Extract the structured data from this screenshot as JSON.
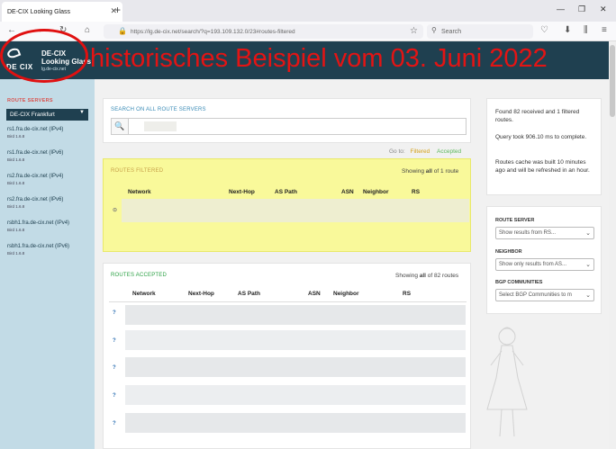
{
  "browser": {
    "tab_title": "DE-CIX Looking Glass",
    "tab_close": "✕",
    "new_tab": "+",
    "url": "https://lg.de-cix.net/search/?q=193.109.132.0/23#routes-filtered",
    "search_placeholder": "Search",
    "win_min": "—",
    "win_max": "❐",
    "win_close": "✕"
  },
  "brand": {
    "logo_text": "DE CIX",
    "title": "DE-CIX Looking Glass",
    "subtitle": "lg.de-cix.net"
  },
  "banner": "historisches Beispiel vom 03. Juni 2022",
  "sidebar": {
    "heading": "ROUTE SERVERS",
    "selected_ixp": "DE-CIX Frankfurt",
    "items": [
      {
        "label": "rs1.fra.de-cix.net (IPv4)",
        "status": "Bird 1.6.8"
      },
      {
        "label": "rs1.fra.de-cix.net (IPv6)",
        "status": "Bird 1.6.8"
      },
      {
        "label": "rs2.fra.de-cix.net (IPv4)",
        "status": "Bird 1.6.8"
      },
      {
        "label": "rs2.fra.de-cix.net (IPv6)",
        "status": "Bird 1.6.8"
      },
      {
        "label": "rsbh1.fra.de-cix.net (IPv4)",
        "status": "Bird 1.6.8"
      },
      {
        "label": "rsbh1.fra.de-cix.net (IPv6)",
        "status": "Bird 1.6.8"
      }
    ]
  },
  "search": {
    "label": "SEARCH ON ALL ROUTE SERVERS",
    "value": ""
  },
  "goto": {
    "prefix": "Go to:",
    "filtered": "Filtered",
    "accepted": "Accepted"
  },
  "routes_filtered": {
    "label": "ROUTES FILTERED",
    "showing_prefix": "Showing ",
    "showing_bold": "all",
    "showing_suffix": " of 1 route",
    "columns": [
      "Network",
      "Next-Hop",
      "AS Path",
      "ASN",
      "Neighbor",
      "RS"
    ]
  },
  "routes_accepted": {
    "label": "ROUTES ACCEPTED",
    "showing_prefix": "Showing ",
    "showing_bold": "all",
    "showing_suffix": " of 82 routes",
    "columns": [
      "Network",
      "Next-Hop",
      "AS Path",
      "ASN",
      "Neighbor",
      "RS"
    ]
  },
  "info": {
    "found": "Found 82 received and 1 filtered routes.",
    "query": "Query took 906.10 ms to complete.",
    "cache": "Routes cache was built 10 minutes ago and will be refreshed in an hour."
  },
  "filters": {
    "route_server_label": "ROUTE SERVER",
    "route_server_value": "Show results from RS...",
    "neighbor_label": "NEIGHBOR",
    "neighbor_value": "Show only results from AS...",
    "community_label": "BGP COMMUNITIES",
    "community_value": "Select BGP Communities to m"
  }
}
